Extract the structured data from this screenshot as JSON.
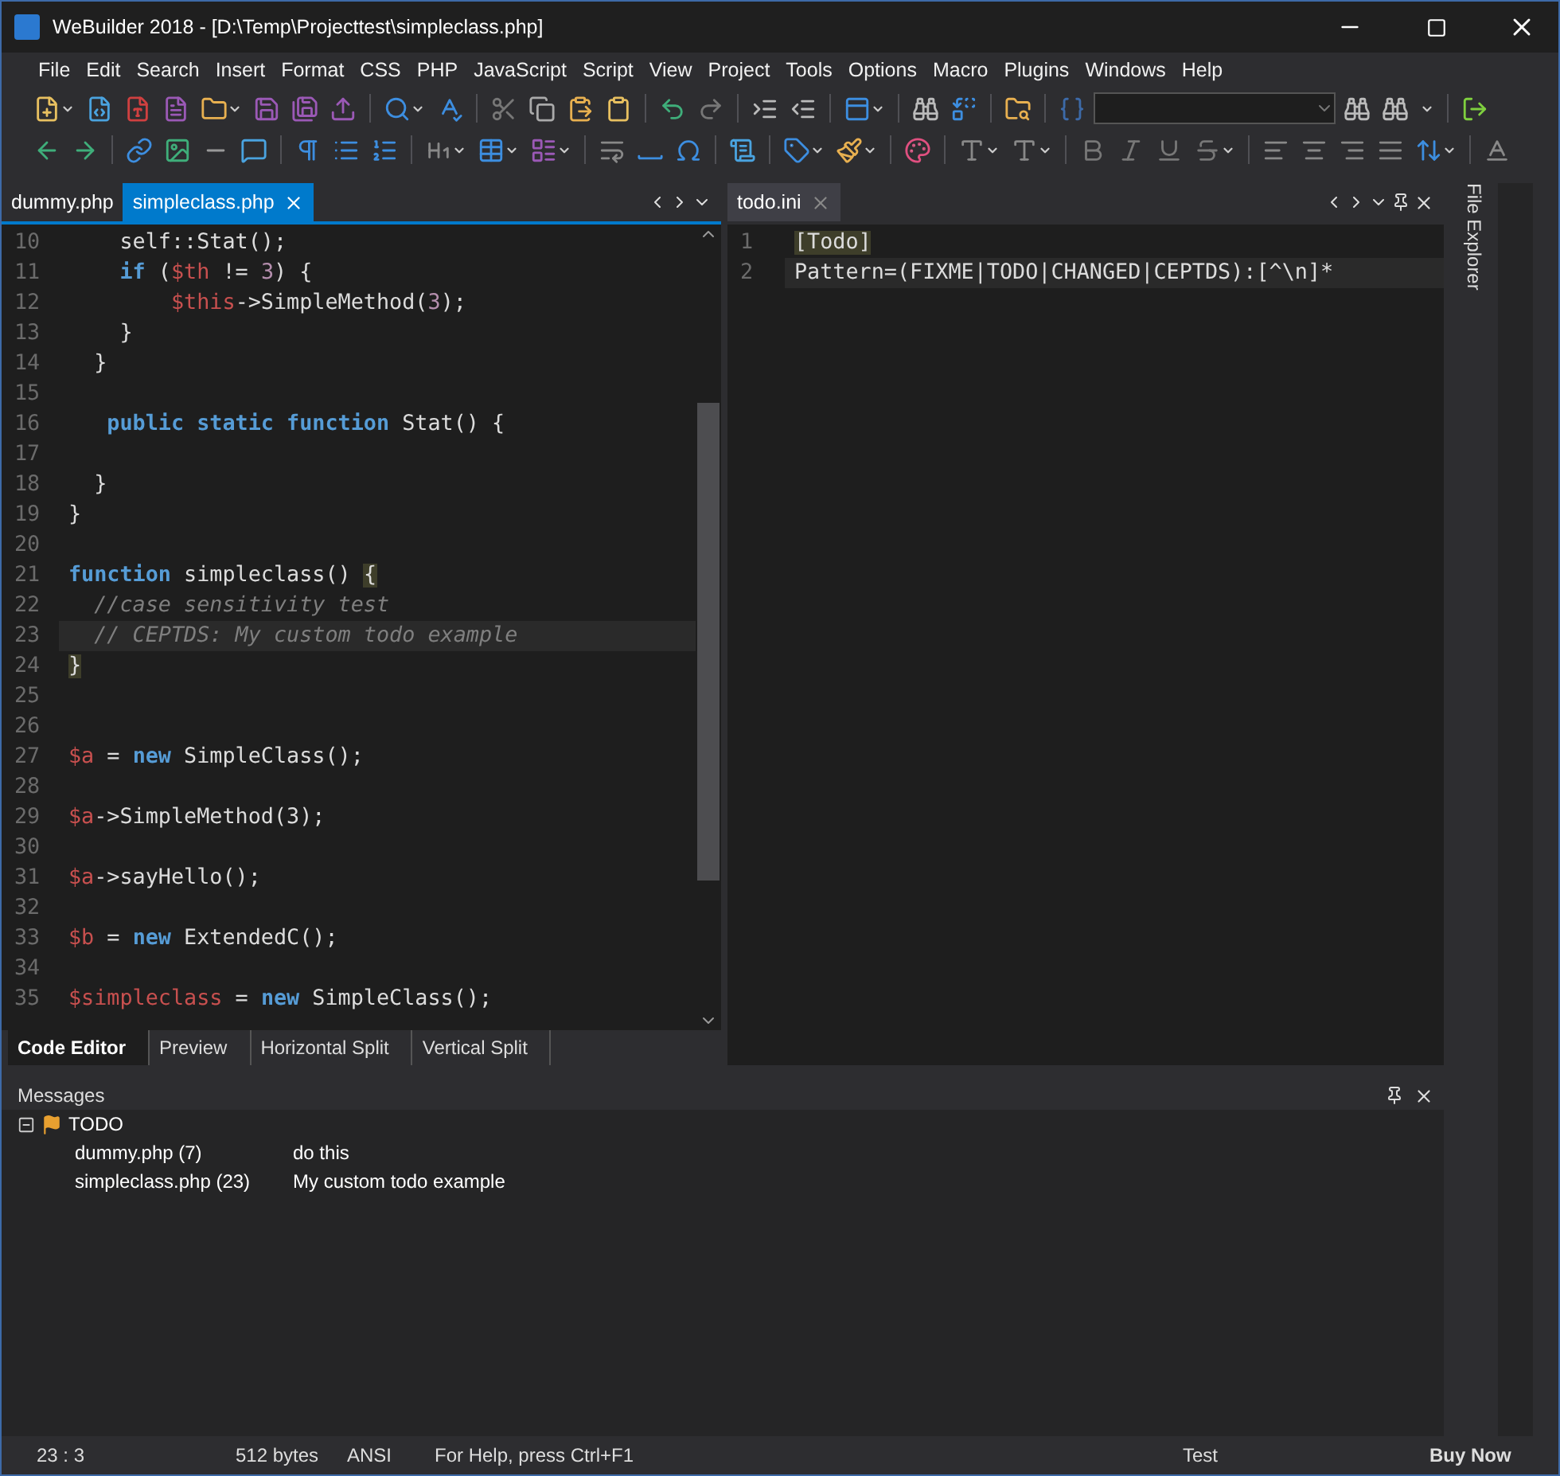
{
  "window": {
    "title": "WeBuilder 2018 - [D:\\Temp\\Projecttest\\simpleclass.php]"
  },
  "menu": [
    "File",
    "Edit",
    "Search",
    "Insert",
    "Format",
    "CSS",
    "PHP",
    "JavaScript",
    "Script",
    "View",
    "Project",
    "Tools",
    "Options",
    "Macro",
    "Plugins",
    "Windows",
    "Help"
  ],
  "left_pane": {
    "tabs": [
      {
        "label": "dummy.php",
        "selected": false
      },
      {
        "label": "simpleclass.php",
        "selected": true
      }
    ],
    "lines": [
      {
        "number": "10",
        "current": false,
        "tokens": [
          {
            "kind": "plain",
            "text": "    self::Stat();"
          }
        ]
      },
      {
        "number": "11",
        "current": false,
        "tokens": [
          {
            "kind": "keyword",
            "text": "    if"
          },
          {
            "kind": "plain",
            "text": " ("
          },
          {
            "kind": "variable",
            "text": "$th"
          },
          {
            "kind": "plain",
            "text": " != "
          },
          {
            "kind": "number",
            "text": "3"
          },
          {
            "kind": "plain",
            "text": ") {"
          }
        ]
      },
      {
        "number": "12",
        "current": false,
        "tokens": [
          {
            "kind": "variable",
            "text": "        $this"
          },
          {
            "kind": "plain",
            "text": "->SimpleMethod("
          },
          {
            "kind": "number",
            "text": "3"
          },
          {
            "kind": "plain",
            "text": ");"
          }
        ]
      },
      {
        "number": "13",
        "current": false,
        "tokens": [
          {
            "kind": "plain",
            "text": "    }"
          }
        ]
      },
      {
        "number": "14",
        "current": false,
        "tokens": [
          {
            "kind": "plain",
            "text": "  }"
          }
        ]
      },
      {
        "number": "15",
        "current": false
      },
      {
        "number": "16",
        "current": false,
        "tokens": [
          {
            "kind": "keyword",
            "text": "   public static function"
          },
          {
            "kind": "plain",
            "text": " Stat() {"
          }
        ]
      },
      {
        "number": "17",
        "current": false
      },
      {
        "number": "18",
        "current": false,
        "tokens": [
          {
            "kind": "plain",
            "text": "  }"
          }
        ]
      },
      {
        "number": "19",
        "current": false,
        "tokens": [
          {
            "kind": "plain",
            "text": "}"
          }
        ]
      },
      {
        "number": "20",
        "current": false
      },
      {
        "number": "21",
        "current": false,
        "tokens": [
          {
            "kind": "keyword",
            "text": "function"
          },
          {
            "kind": "plain",
            "text": " simpleclass() "
          },
          {
            "kind": "match",
            "text": "{"
          }
        ]
      },
      {
        "number": "22",
        "current": false,
        "tokens": [
          {
            "kind": "comment",
            "text": "  //case sensitivity test"
          }
        ]
      },
      {
        "number": "23",
        "current": true,
        "tokens": [
          {
            "kind": "comment",
            "text": "  // CEPTDS: My custom todo example"
          }
        ]
      },
      {
        "number": "24",
        "current": false,
        "tokens": [
          {
            "kind": "match",
            "text": "}"
          }
        ]
      },
      {
        "number": "25",
        "current": false
      },
      {
        "number": "26",
        "current": false
      },
      {
        "number": "27",
        "current": false,
        "tokens": [
          {
            "kind": "variable",
            "text": "$a"
          },
          {
            "kind": "plain",
            "text": " = "
          },
          {
            "kind": "keyword",
            "text": "new"
          },
          {
            "kind": "plain",
            "text": " SimpleClass();"
          }
        ]
      },
      {
        "number": "28",
        "current": false
      },
      {
        "number": "29",
        "current": false,
        "tokens": [
          {
            "kind": "variable",
            "text": "$a"
          },
          {
            "kind": "plain",
            "text": "->SimpleMethod(3);"
          }
        ]
      },
      {
        "number": "30",
        "current": false
      },
      {
        "number": "31",
        "current": false,
        "tokens": [
          {
            "kind": "variable",
            "text": "$a"
          },
          {
            "kind": "plain",
            "text": "->sayHello();"
          }
        ]
      },
      {
        "number": "32",
        "current": false
      },
      {
        "number": "33",
        "current": false,
        "tokens": [
          {
            "kind": "variable",
            "text": "$b"
          },
          {
            "kind": "plain",
            "text": " = "
          },
          {
            "kind": "keyword",
            "text": "new"
          },
          {
            "kind": "plain",
            "text": " ExtendedC();"
          }
        ]
      },
      {
        "number": "34",
        "current": false
      },
      {
        "number": "35",
        "current": false,
        "tokens": [
          {
            "kind": "variable",
            "text": "$simpleclass"
          },
          {
            "kind": "plain",
            "text": " = "
          },
          {
            "kind": "keyword",
            "text": "new"
          },
          {
            "kind": "plain",
            "text": " SimpleClass();"
          }
        ]
      }
    ],
    "view_tabs": [
      {
        "label": "Code Editor",
        "selected": true
      },
      {
        "label": "Preview",
        "selected": false
      },
      {
        "label": "Horizontal Split",
        "selected": false
      },
      {
        "label": "Vertical Split",
        "selected": false
      }
    ]
  },
  "right_pane": {
    "tabs": [
      {
        "label": "todo.ini",
        "selected": true
      }
    ],
    "lines": [
      {
        "number": "1",
        "current": false,
        "tokens": [
          {
            "kind": "match",
            "text": "[Todo]"
          }
        ]
      },
      {
        "number": "2",
        "current": true,
        "tokens": [
          {
            "kind": "plain",
            "text": "Pattern=(FIXME|TODO|CHANGED|CEPTDS):[^\\n]*"
          }
        ]
      }
    ]
  },
  "side_panel": {
    "label": "File Explorer"
  },
  "messages": {
    "title": "Messages",
    "groups": [
      {
        "label": "TODO",
        "expanded": true,
        "children": [
          {
            "file": "dummy.php (7)",
            "text": "do this"
          },
          {
            "file": "simpleclass.php (23)",
            "text": "My custom todo example"
          }
        ]
      }
    ]
  },
  "status_bar": {
    "position": "23 : 3",
    "size": "512 bytes",
    "encoding": "ANSI",
    "help": "For Help, press Ctrl+F1",
    "mode": "Test",
    "buy": "Buy Now"
  }
}
